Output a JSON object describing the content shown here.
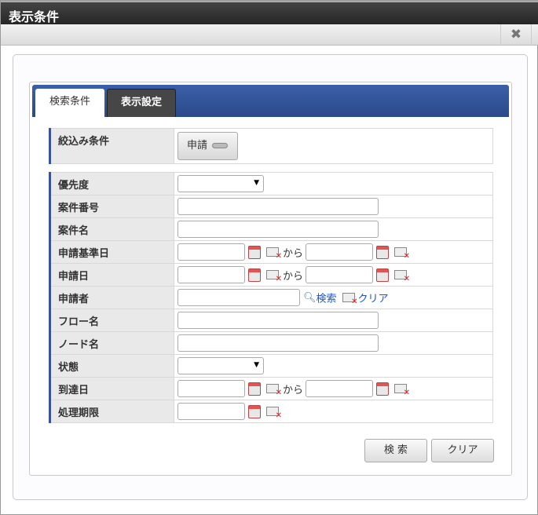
{
  "window": {
    "title": "表示条件",
    "close_icon": "close-icon"
  },
  "tabs": [
    {
      "label": "検索条件",
      "active": true
    },
    {
      "label": "表示設定",
      "active": false
    }
  ],
  "filter": {
    "label": "絞込み条件",
    "toggle_label": "申請"
  },
  "fields": {
    "priority": "優先度",
    "matter_number": "案件番号",
    "matter_name": "案件名",
    "base_date": "申請基準日",
    "apply_date": "申請日",
    "applicant": "申請者",
    "flow_name": "フロー名",
    "node_name": "ノード名",
    "status": "状態",
    "arrival_date": "到達日",
    "deadline": "処理期限"
  },
  "range_sep": "から",
  "applicant_search_link": "検索",
  "applicant_clear_link": "クリア",
  "buttons": {
    "search": "検 索",
    "clear": "クリア"
  }
}
